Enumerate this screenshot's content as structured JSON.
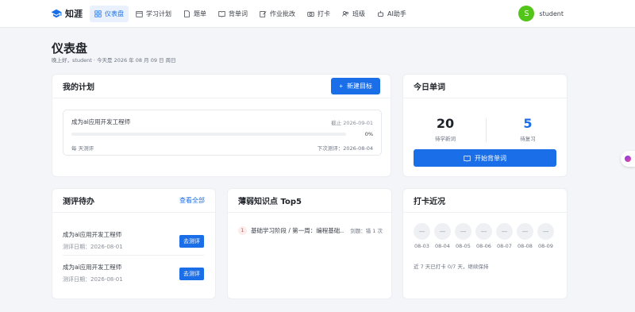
{
  "app": {
    "name": "知涯"
  },
  "nav": [
    {
      "label": "仪表盘",
      "icon": "dashboard-icon",
      "active": true
    },
    {
      "label": "学习计划",
      "icon": "calendar-icon"
    },
    {
      "label": "题单",
      "icon": "document-icon"
    },
    {
      "label": "背单词",
      "icon": "book-icon"
    },
    {
      "label": "作业批改",
      "icon": "edit-icon"
    },
    {
      "label": "打卡",
      "icon": "camera-icon"
    },
    {
      "label": "班级",
      "icon": "users-icon"
    },
    {
      "label": "AI助手",
      "icon": "robot-icon"
    }
  ],
  "user": {
    "avatar": "S",
    "name": "student"
  },
  "header": {
    "title": "仪表盘",
    "greeting": "晚上好，student · 今天是 2026 年 08 月 09 日 周日"
  },
  "plans": {
    "title": "我的计划",
    "new_button": "新建目标",
    "items": [
      {
        "name": "成为ai应用开发工程师",
        "deadline": "截止 2026-09-01",
        "progress_pct": 0,
        "progress_label": "0%",
        "frequency": "每 天测评",
        "next_test": "下次测评：2026-08-04"
      }
    ]
  },
  "words": {
    "title": "今日单词",
    "new_count": "20",
    "new_label": "待学新词",
    "review_count": "5",
    "review_label": "待复习",
    "start_button": "开始背单词"
  },
  "todo": {
    "title": "测评待办",
    "view_all": "查看全部",
    "items": [
      {
        "name": "成为ai应用开发工程师",
        "date": "测评日期：2026-08-01",
        "button": "去测评"
      },
      {
        "name": "成为ai应用开发工程师",
        "date": "测评日期：2026-08-01",
        "button": "去测评"
      }
    ]
  },
  "weak": {
    "title": "薄弱知识点 Top5",
    "items": [
      {
        "rank": "1",
        "name": "基础学习阶段 / 第一周：编程基础…",
        "count": "剑题：错 1 次"
      }
    ]
  },
  "checkin": {
    "title": "打卡近况",
    "days": [
      {
        "date": "08-03",
        "mark": "—"
      },
      {
        "date": "08-04",
        "mark": "—"
      },
      {
        "date": "08-05",
        "mark": "—"
      },
      {
        "date": "08-06",
        "mark": "—"
      },
      {
        "date": "08-07",
        "mark": "—"
      },
      {
        "date": "08-08",
        "mark": "—"
      },
      {
        "date": "08-09",
        "mark": "—"
      }
    ],
    "summary": "近 7 天已打卡 0/7 天，继续保持"
  },
  "colors": {
    "primary": "#1a6fe8",
    "avatar": "#52c41a",
    "danger": "#e5484d"
  }
}
